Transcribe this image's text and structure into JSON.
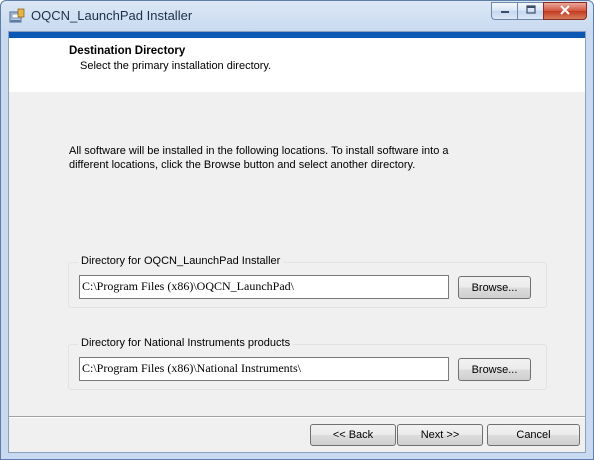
{
  "window": {
    "title": "OQCN_LaunchPad Installer",
    "icon": "installer-icon",
    "controls": {
      "minimize": "minimize-icon",
      "maximize": "maximize-icon",
      "close": "close-icon"
    }
  },
  "banner": {
    "title": "Destination Directory",
    "subtitle": "Select the primary installation directory."
  },
  "intro": "All software will be installed in the following locations. To install software into a different locations, click the Browse button and select another directory.",
  "groups": [
    {
      "label": "Directory for OQCN_LaunchPad Installer",
      "path": "C:\\Program Files (x86)\\OQCN_LaunchPad\\",
      "button": "Browse..."
    },
    {
      "label": "Directory for National Instruments products",
      "path": "C:\\Program Files (x86)\\National Instruments\\",
      "button": "Browse..."
    }
  ],
  "footer": {
    "back": "<< Back",
    "next": "Next >>",
    "cancel": "Cancel"
  },
  "colors": {
    "banner_accent": "#0b57b5",
    "dialog_background": "#f0f0f0",
    "close_button": "#c23a20"
  }
}
